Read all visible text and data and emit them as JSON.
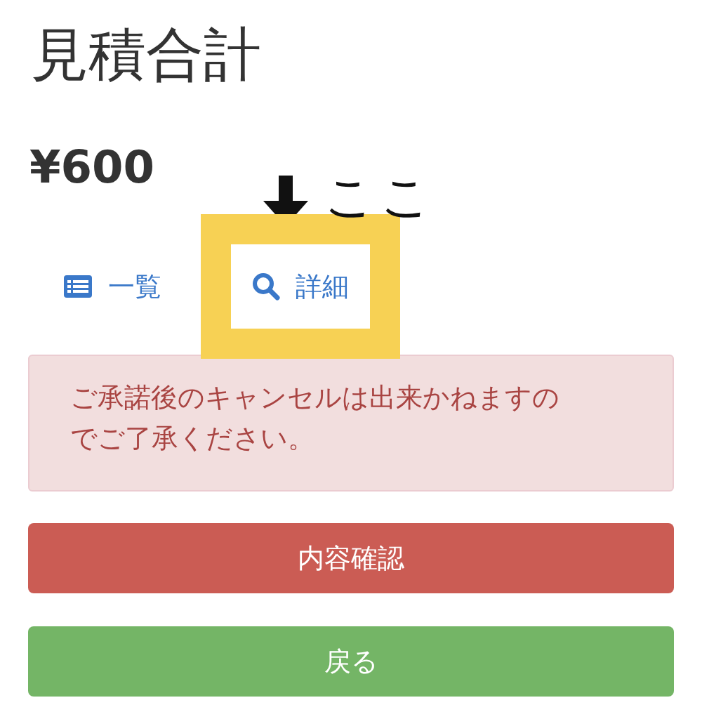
{
  "title": "見積合計",
  "total": "¥600",
  "annotation": {
    "label": "ここ"
  },
  "tabs": [
    {
      "label": "一覧",
      "highlighted": false
    },
    {
      "label": "詳細",
      "highlighted": true
    }
  ],
  "alert": {
    "message": "ご承諾後のキャンセルは出来かねますのでご了承ください。"
  },
  "buttons": [
    {
      "label": "内容確認",
      "kind": "danger"
    },
    {
      "label": "戻る",
      "kind": "success"
    }
  ]
}
